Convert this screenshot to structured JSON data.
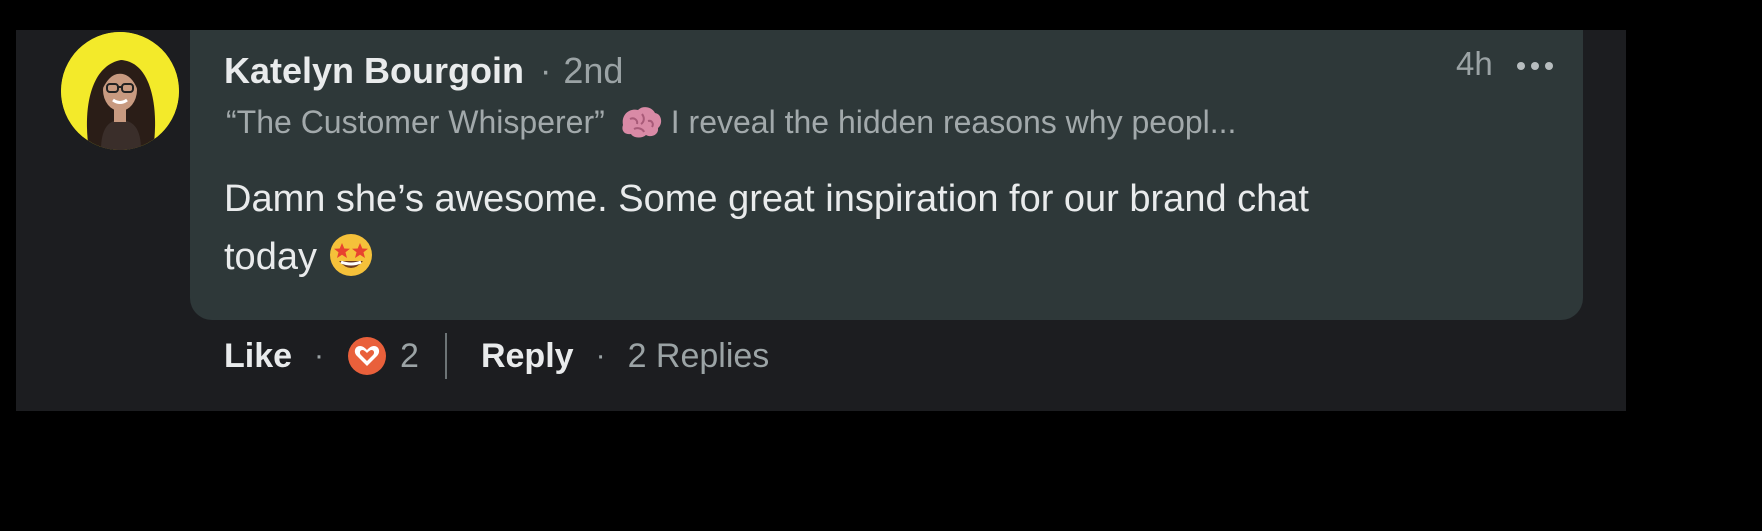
{
  "comment": {
    "author": "Katelyn Bourgoin",
    "separator": "·",
    "connection_degree": "2nd",
    "timestamp": "4h",
    "headline_before_emoji": "“The Customer Whisperer”",
    "headline_after_emoji": "I reveal the hidden reasons why peopl...",
    "body_line_1": "Damn she’s awesome. Some great inspiration for our brand chat",
    "body_line_2": "today",
    "body_emoji": "star-struck-emoji",
    "headline_emoji": "brain-emoji"
  },
  "actions": {
    "like_label": "Like",
    "dot": "·",
    "reaction_count": "2",
    "reaction_icon": "heart-reaction-icon",
    "reply_label": "Reply",
    "replies_label": "2 Replies"
  },
  "colors": {
    "avatar_background": "#f3ea2a",
    "bubble_background": "#2e3839",
    "panel_background": "#1c1d20",
    "reaction_color": "#e9603b"
  }
}
